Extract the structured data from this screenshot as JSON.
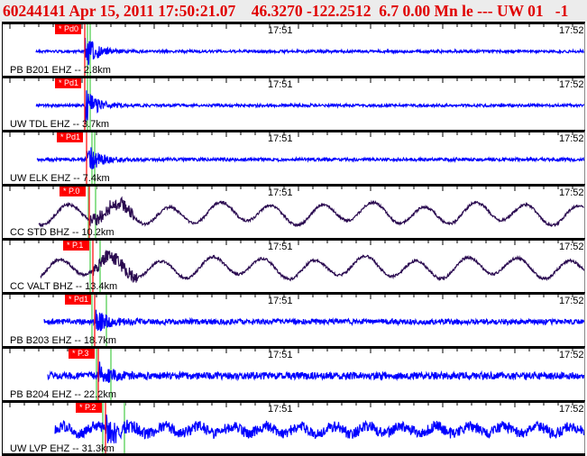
{
  "header": {
    "title": "60244141 Apr 15, 2011 17:50:21.07    46.3270 -122.2512  6.7 0.00 Mn le --- UW 01   -1"
  },
  "colors": {
    "short_period": "#0000ff",
    "broadband": "#2a0a50",
    "pick_box": "#ff0000",
    "pick_line": "#ff0000",
    "theoretical_line": "#90e090"
  },
  "time_labels": [
    "17:51",
    "17:52"
  ],
  "channels": [
    {
      "label": "PB B201 EHZ -- 2.8km",
      "pick": "* Pd0",
      "type": "short"
    },
    {
      "label": "UW TDL EHZ -- 3.7km",
      "pick": "* Pd1",
      "type": "short"
    },
    {
      "label": "UW ELK EHZ -- 7.4km",
      "pick": "* Pd1",
      "type": "short"
    },
    {
      "label": "CC STD BHZ -- 10.2km",
      "pick": "* P.0",
      "type": "broad"
    },
    {
      "label": "CC VALT BHZ -- 13.4km",
      "pick": "* P.1",
      "type": "broad"
    },
    {
      "label": "PB B203 EHZ -- 18.7km",
      "pick": "* Pd1",
      "type": "short"
    },
    {
      "label": "PB B204 EHZ -- 22.2km",
      "pick": "* P.3",
      "type": "short"
    },
    {
      "label": "UW LVP EHZ -- 31.3km",
      "pick": "* P.2",
      "type": "short"
    }
  ]
}
